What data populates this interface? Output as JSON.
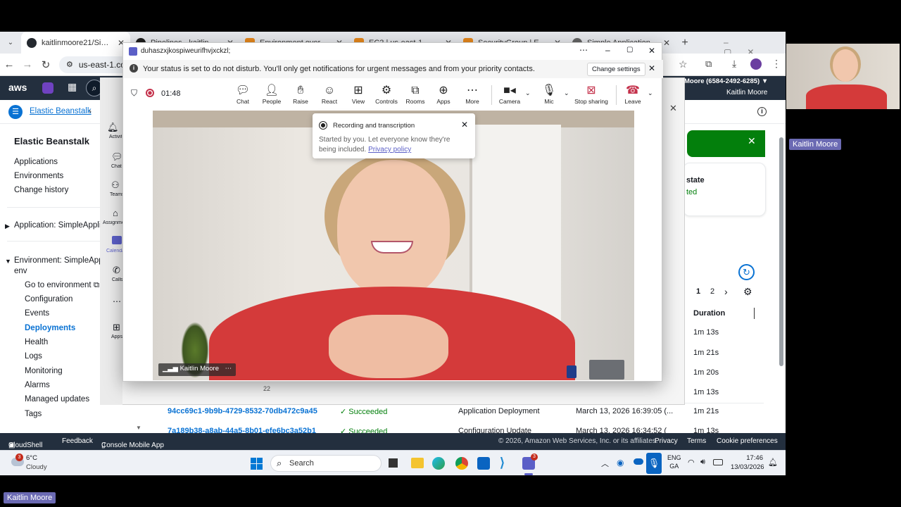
{
  "browser": {
    "tabs": [
      {
        "title": "kaitlinmoore21/SimpleApp",
        "color": "#24292f"
      },
      {
        "title": "Pipelines - kaitlinmoore21",
        "color": "#1f1f1f"
      },
      {
        "title": "Environment overview",
        "color": "#e8891c"
      },
      {
        "title": "EC2 | us-east-1",
        "color": "#e8891c"
      },
      {
        "title": "SecurityGroup | EC2 | us-e",
        "color": "#e8891c"
      },
      {
        "title": "Simple Application",
        "color": "#666666"
      }
    ],
    "url": "us-east-1.con"
  },
  "aws": {
    "logo": "aws",
    "account": "Moore (6584-2492-6285) ▼",
    "user": "Kaitlin Moore",
    "breadcrumb": "Elastic Beanstalk",
    "nav": {
      "title": "Elastic Beanstalk",
      "items": [
        "Applications",
        "Environments",
        "Change history"
      ],
      "app_group": "Application: SimpleApplica",
      "env_group_line1": "Environment: SimpleApplic",
      "env_group_line2": "env",
      "env_items": [
        "Go to environment",
        "Configuration",
        "Events",
        "Deployments",
        "Health",
        "Logs",
        "Monitoring",
        "Alarms",
        "Managed updates",
        "Tags"
      ],
      "selected": "Deployments"
    },
    "status_partial": {
      "label": "state",
      "value": "ted"
    },
    "pager": {
      "page1": "1",
      "page2": "2"
    },
    "table": {
      "duration_header": "Duration",
      "durations": [
        "1m 13s",
        "1m 21s",
        "1m 20s",
        "1m 13s"
      ],
      "row_number": "22",
      "rows": [
        {
          "id": "94cc69c1-9b9b-4729-8532-70db472c9a45",
          "status": "Succeeded",
          "type": "Application Deployment",
          "date": "March 13, 2026 16:39:05 (...",
          "duration": "1m 21s"
        },
        {
          "id": "7a189b38-a8ab-44a5-8b01-efe6bc3a52b1",
          "status": "Succeeded",
          "type": "Configuration Update",
          "date": "March 13, 2026 16:34:52 (",
          "duration": "1m 13s"
        }
      ]
    },
    "footer": {
      "cloudshell": "CloudShell",
      "feedback": "Feedback",
      "mobile": "Console Mobile App",
      "copyright": "© 2026, Amazon Web Services, Inc. or its affiliates.",
      "privacy": "Privacy",
      "terms": "Terms",
      "cookies": "Cookie preferences"
    }
  },
  "teams": {
    "window_title": "duhaszxjkospiweurifhvjxckzl;",
    "banner": "Your status is set to do not disturb. You'll only get notifications for urgent messages and from your priority contacts.",
    "change_settings": "Change settings",
    "timer": "01:48",
    "toolbar": [
      "Chat",
      "People",
      "Raise",
      "React",
      "View",
      "Controls",
      "Rooms",
      "Apps",
      "More",
      "Camera",
      "Mic",
      "Stop sharing",
      "Leave"
    ],
    "rail": [
      "Activity",
      "Chat",
      "Teams",
      "Assignments",
      "Calendar",
      "Calls",
      "Apps"
    ],
    "recording": {
      "title": "Recording and transcription",
      "body": "Started by you. Let everyone know they're being included.",
      "link": "Privacy policy"
    },
    "participant": "Kaitlin Moore"
  },
  "taskbar": {
    "weather_temp": "6°C",
    "weather_desc": "Cloudy",
    "weather_badge": "3",
    "search": "Search",
    "lang1": "ENG",
    "lang2": "GA",
    "time": "17:46",
    "date": "13/03/2026",
    "teams_badge": "3"
  },
  "overlay_names": {
    "side": "Kaitlin Moore",
    "bottom": "Kaitlin Moore"
  }
}
